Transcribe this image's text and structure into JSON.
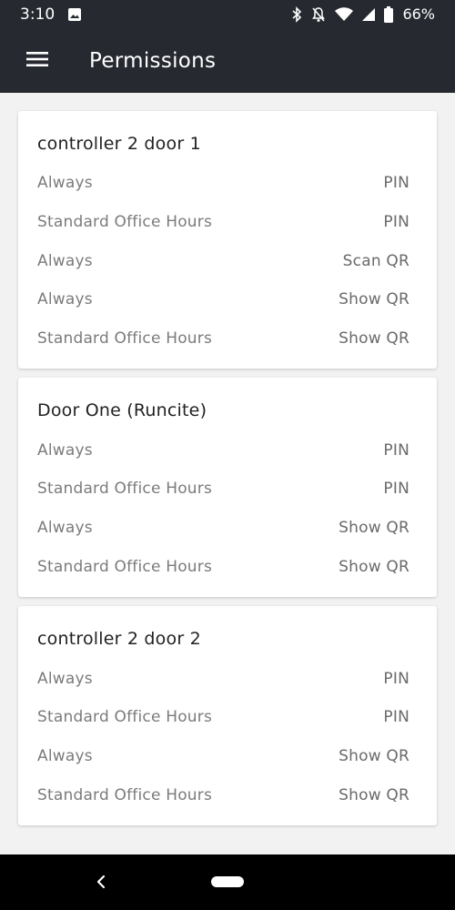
{
  "status_bar": {
    "time": "3:10",
    "battery": "66%",
    "icons": [
      "image-icon",
      "bluetooth-icon",
      "notifications-off-icon",
      "wifi-icon",
      "signal-icon",
      "battery-icon"
    ]
  },
  "app_bar": {
    "title": "Permissions",
    "menu_icon": "hamburger-menu-icon"
  },
  "cards": [
    {
      "title": "controller 2 door 1",
      "rows": [
        {
          "schedule": "Always",
          "method": "PIN"
        },
        {
          "schedule": "Standard Office Hours",
          "method": "PIN"
        },
        {
          "schedule": "Always",
          "method": "Scan QR"
        },
        {
          "schedule": "Always",
          "method": "Show QR"
        },
        {
          "schedule": "Standard Office Hours",
          "method": "Show QR"
        }
      ]
    },
    {
      "title": "Door One (Runcite)",
      "rows": [
        {
          "schedule": "Always",
          "method": "PIN"
        },
        {
          "schedule": "Standard Office Hours",
          "method": "PIN"
        },
        {
          "schedule": "Always",
          "method": "Show QR"
        },
        {
          "schedule": "Standard Office Hours",
          "method": "Show QR"
        }
      ]
    },
    {
      "title": "controller 2 door 2",
      "rows": [
        {
          "schedule": "Always",
          "method": "PIN"
        },
        {
          "schedule": "Standard Office Hours",
          "method": "PIN"
        },
        {
          "schedule": "Always",
          "method": "Show QR"
        },
        {
          "schedule": "Standard Office Hours",
          "method": "Show QR"
        }
      ]
    }
  ],
  "nav_bar": {
    "back_icon": "back-chevron-icon",
    "home_icon": "home-pill-icon"
  }
}
